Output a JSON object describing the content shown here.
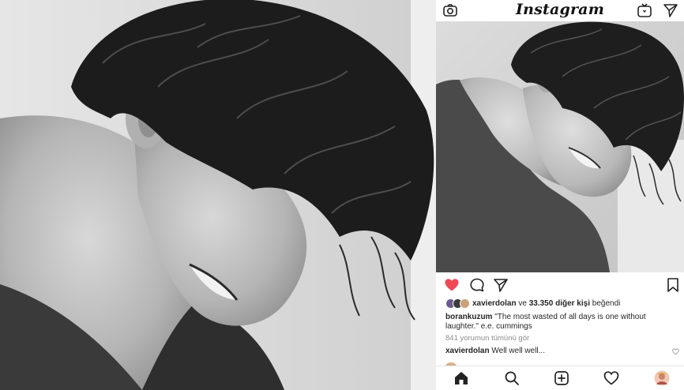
{
  "app": {
    "title": "Instagram"
  },
  "icons": {
    "camera": "camera-icon",
    "igtv": "igtv-icon",
    "direct": "direct-message-icon",
    "like": "heart-icon",
    "comment": "comment-icon",
    "share": "share-icon",
    "bookmark": "bookmark-icon",
    "home": "home-icon",
    "search": "search-icon",
    "add": "add-post-icon",
    "activity": "activity-heart-icon",
    "profile": "profile-avatar"
  },
  "colors": {
    "like": "#ed4956",
    "text": "#262626",
    "muted": "#8e8e8e"
  },
  "post": {
    "liked": true,
    "likes": {
      "user": "xavierdolan",
      "connector": " ve ",
      "count_text": "33.350 diğer kişi",
      "suffix": " beğendi"
    },
    "caption": {
      "user": "borankuzum",
      "text": " \"The most wasted of all days is one without laughter.\" e.e. cummings"
    },
    "view_comments": "841 yorumun tümünü gör",
    "comment": {
      "user": "xavierdolan",
      "text": " Well well well..."
    }
  }
}
